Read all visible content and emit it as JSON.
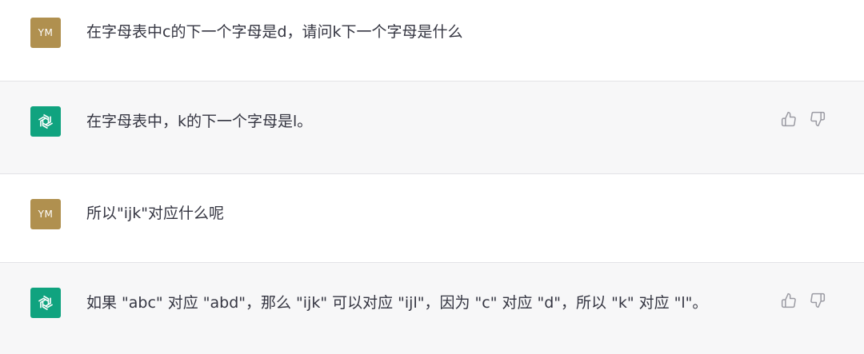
{
  "conversation": [
    {
      "role": "user",
      "avatar_initials": "YM",
      "text": "在字母表中c的下一个字母是d，请问k下一个字母是什么"
    },
    {
      "role": "assistant",
      "avatar_icon": "chatgpt-logo-icon",
      "text": "在字母表中，k的下一个字母是l。"
    },
    {
      "role": "user",
      "avatar_initials": "YM",
      "text": "所以\"ijk\"对应什么呢"
    },
    {
      "role": "assistant",
      "avatar_icon": "chatgpt-logo-icon",
      "text": "如果 \"abc\" 对应 \"abd\"，那么 \"ijk\" 可以对应 \"ijl\"，因为 \"c\" 对应 \"d\"，所以 \"k\" 对应 \"l\"。"
    }
  ],
  "feedback_icons": {
    "like": "thumbs-up-icon",
    "dislike": "thumbs-down-icon"
  },
  "colors": {
    "user_avatar": "#b0904f",
    "assistant_avatar": "#10a37f",
    "assistant_bg": "#f7f7f8",
    "text": "#343541",
    "icon": "#9b9ba3"
  }
}
